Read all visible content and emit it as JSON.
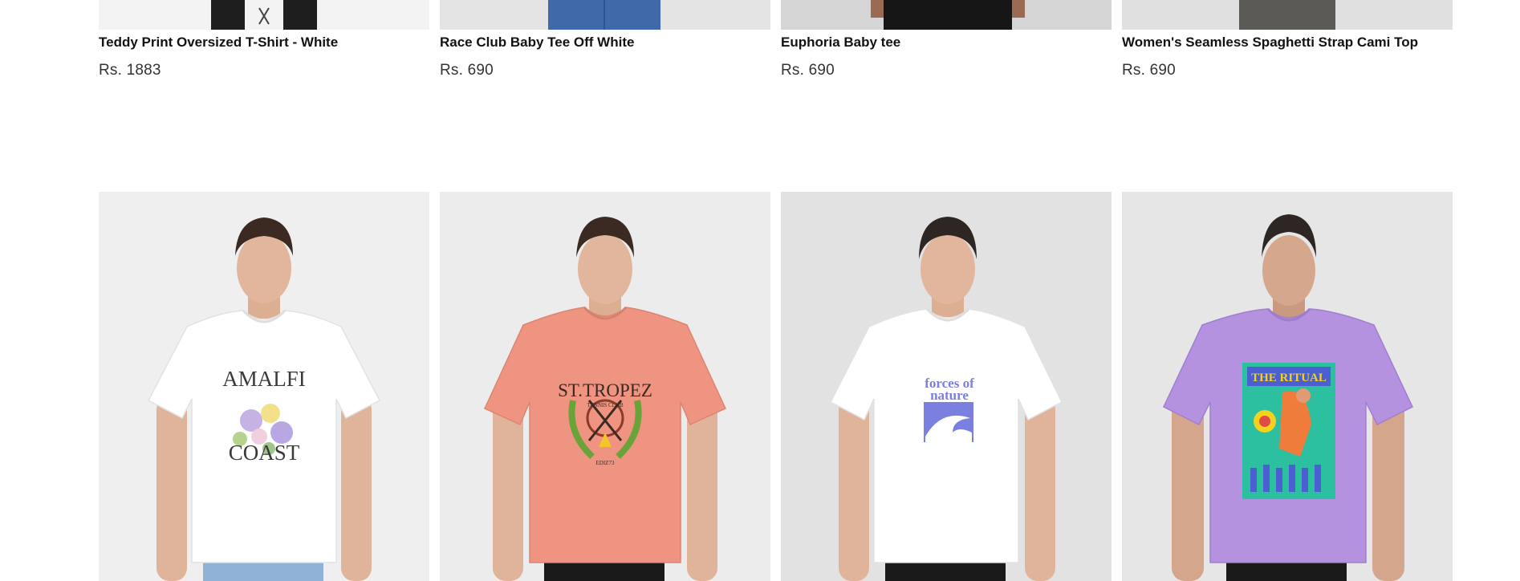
{
  "products_row1": [
    {
      "title": "Teddy Print Oversized T-Shirt - White",
      "price": "Rs. 1883"
    },
    {
      "title": "Race Club Baby Tee Off White",
      "price": "Rs. 690"
    },
    {
      "title": "Euphoria Baby tee",
      "price": "Rs. 690"
    },
    {
      "title": "Women's Seamless Spaghetti Strap Cami Top",
      "price": "Rs. 690"
    }
  ],
  "products_row2": [
    {
      "shirt_color": "#ffffff",
      "graphic_lines": [
        "AMALFI",
        "COAST"
      ],
      "graphic_color": "#3a3a3a"
    },
    {
      "shirt_color": "#ee9481",
      "graphic_lines": [
        "ST.TROPEZ",
        "TENNIS CLUB",
        "EDIZ73"
      ],
      "graphic_color": "#3a2a22"
    },
    {
      "shirt_color": "#ffffff",
      "graphic_lines": [
        "forces of",
        "nature"
      ],
      "graphic_color": "#7a7fe0"
    },
    {
      "shirt_color": "#b592e0",
      "graphic_lines": [
        "THE RITUAL"
      ],
      "graphic_color": "#f2d21c"
    }
  ],
  "colors": {
    "photo_background": "#ececec",
    "title_text": "#121212",
    "price_text": "#333333"
  }
}
